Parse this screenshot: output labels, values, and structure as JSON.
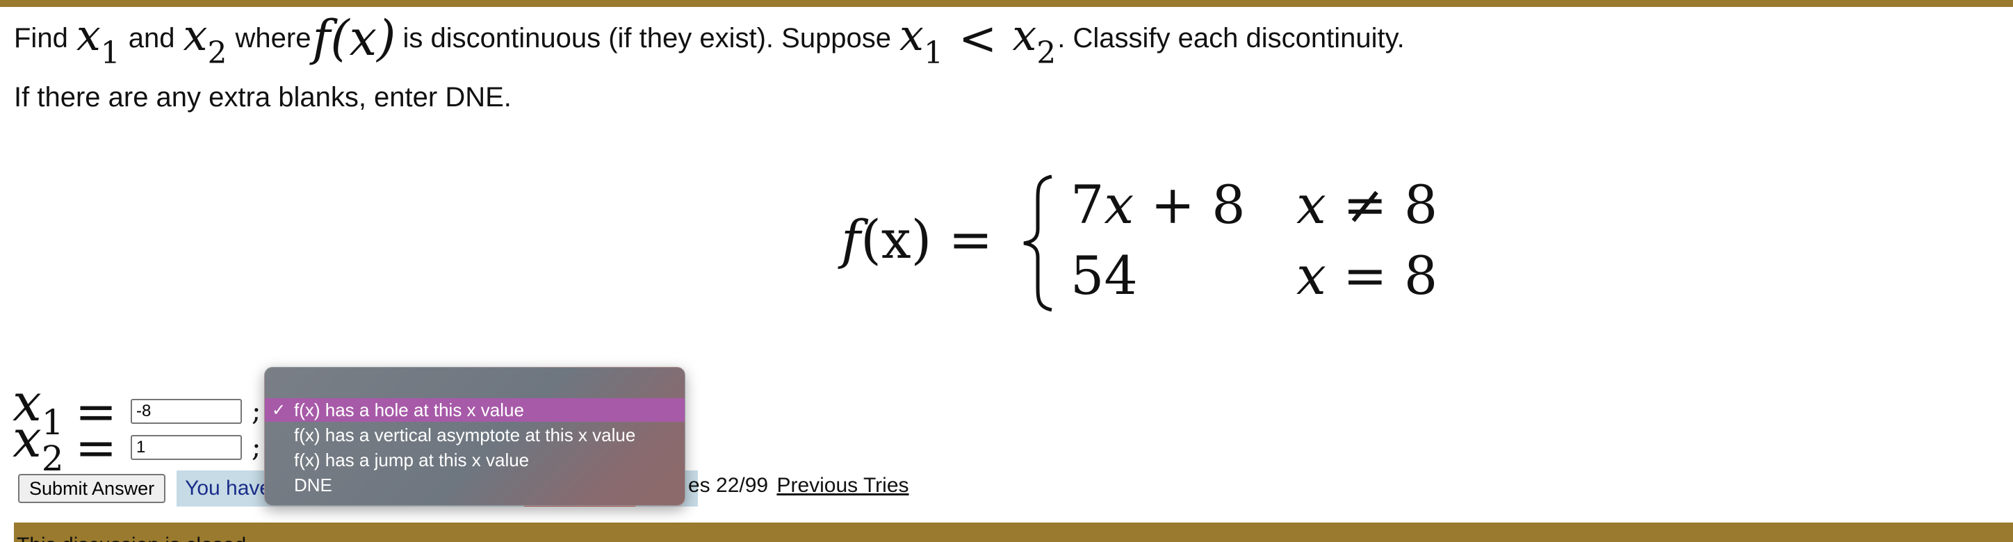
{
  "question": {
    "part1": "Find",
    "x1_var": "x",
    "x1_sub": "1",
    "part2": "and",
    "x2_var": "x",
    "x2_sub": "2",
    "part3": "where",
    "fx": "f(x)",
    "part4": "is discontinuous (if they exist). Suppose",
    "lt": "<",
    "part5": ". Classify each discontinuity."
  },
  "instruction": "If there are any extra blanks, enter DNE.",
  "piecewise": {
    "lhs_f": "f",
    "lhs_rest": "(x) =",
    "row1_expr_coef": "7",
    "row1_expr_var": "x",
    "row1_expr_rest": " + 8",
    "row1_cond_var": "x",
    "row1_cond_rest": " ≠ 8",
    "row2_expr": "54",
    "row2_cond_var": "x",
    "row2_cond_rest": " = 8"
  },
  "answers": {
    "x1": {
      "var": "x",
      "sub": "1",
      "eq": "=",
      "value": "-8"
    },
    "x2": {
      "var": "x",
      "sub": "2",
      "eq": "=",
      "value": "1"
    }
  },
  "semicolon": ";",
  "submit_label": "Submit Answer",
  "tries": {
    "prefix": "You have",
    "suffix": "es 22/99",
    "previous_tries_link": "Previous Tries"
  },
  "dropdown": {
    "options": [
      {
        "label": "f(x) has a hole at this x value",
        "selected": true
      },
      {
        "label": "f(x) has a vertical asymptote at this x value",
        "selected": false
      },
      {
        "label": "f(x) has a jump at this x value",
        "selected": false
      },
      {
        "label": "DNE",
        "selected": false
      }
    ],
    "check_glyph": "✓"
  },
  "footer_text": "This discussion is closed.",
  "colors": {
    "band": "#9a7a2e",
    "tries_bg": "#c6dbe6",
    "tries_text": "#1a2d8a",
    "menu_selected": "#a75aa8"
  }
}
